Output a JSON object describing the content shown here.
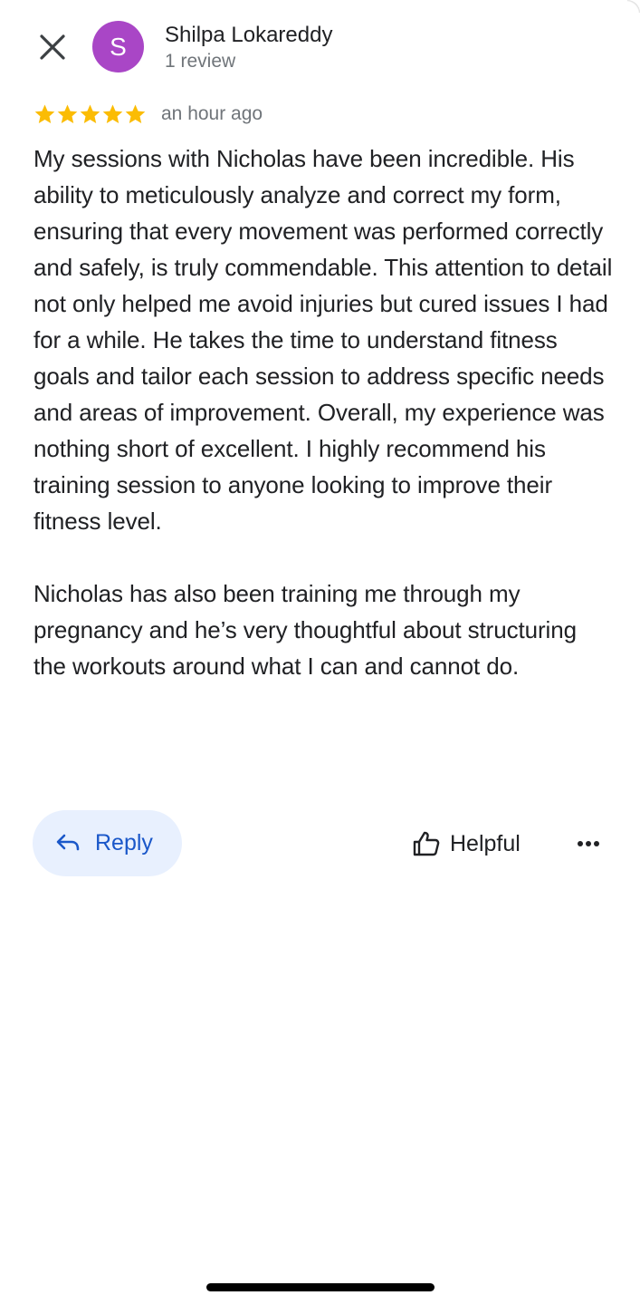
{
  "header": {
    "close_icon": "close-icon",
    "avatar_letter": "S",
    "avatar_color": "#a946c6",
    "author_name": "Shilpa Lokareddy",
    "author_meta": "1 review"
  },
  "rating": {
    "stars": 5,
    "max_stars": 5,
    "star_color": "#fbbc04",
    "time_ago": "an hour ago"
  },
  "review": {
    "paragraphs": [
      "My sessions with Nicholas have been incredible. His ability to meticulously analyze and correct my form, ensuring that every movement was performed correctly and safely, is truly commendable. This attention to detail not only helped me avoid injuries but cured issues I had for a while. He takes the time to understand fitness goals and tailor each session to address specific needs and areas of improvement. Overall, my experience was nothing short of excellent. I highly recommend his training session to anyone looking to improve their fitness level.",
      "Nicholas has also been training me through my pregnancy and he’s very thoughtful about structuring the workouts around what I can and cannot do."
    ]
  },
  "actions": {
    "reply_label": "Reply",
    "reply_icon": "reply-arrow-icon",
    "helpful_label": "Helpful",
    "helpful_icon": "thumbs-up-icon",
    "more_icon": "more-horizontal-icon"
  },
  "colors": {
    "accent_blue": "#1a57c9",
    "reply_bg": "#e8f0fe",
    "secondary_text": "#70757a",
    "primary_text": "#202124"
  }
}
